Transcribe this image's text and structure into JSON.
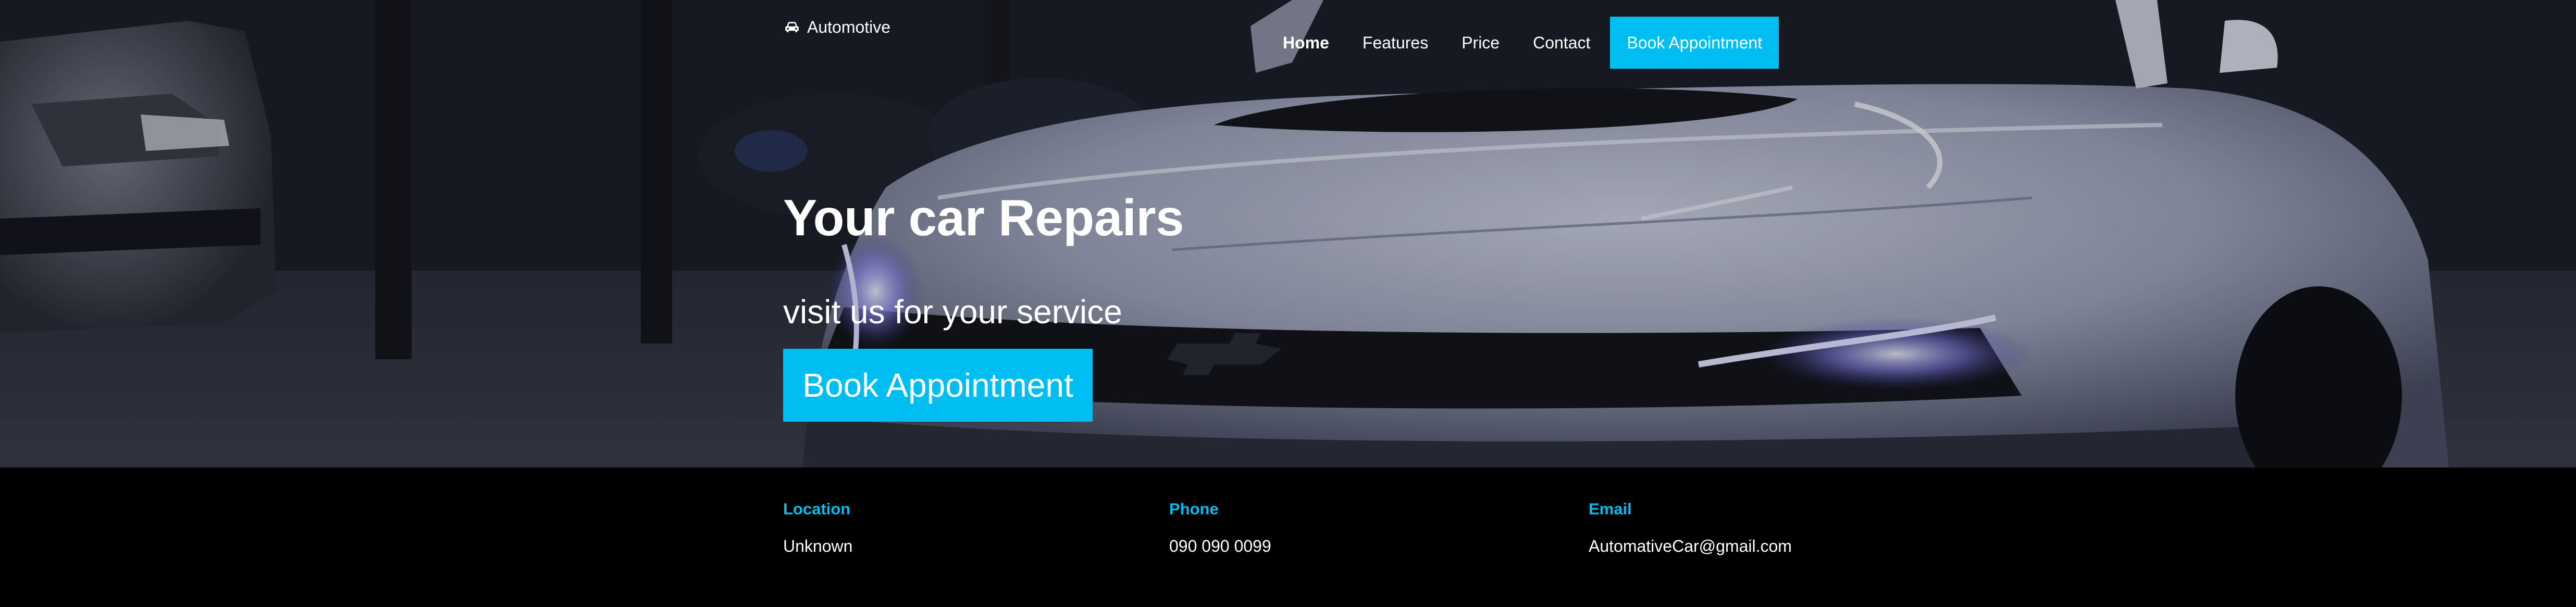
{
  "brand": {
    "icon": "car-icon",
    "name": "Automotive"
  },
  "nav": {
    "items": [
      {
        "label": "Home",
        "active": true
      },
      {
        "label": "Features",
        "active": false
      },
      {
        "label": "Price",
        "active": false
      },
      {
        "label": "Contact",
        "active": false
      }
    ],
    "cta_label": "Book Appointment"
  },
  "hero": {
    "title": "Your car Repairs",
    "subtitle": "visit us for your service",
    "cta_label": "Book Appointment"
  },
  "info": {
    "location": {
      "label": "Location",
      "value": "Unknown"
    },
    "phone": {
      "label": "Phone",
      "value": "090 090 0099"
    },
    "email": {
      "label": "Email",
      "value": "AutomativeCar@gmail.com"
    }
  },
  "colors": {
    "accent": "#00bdf2",
    "footer_bg": "#000000",
    "text": "#ffffff"
  }
}
